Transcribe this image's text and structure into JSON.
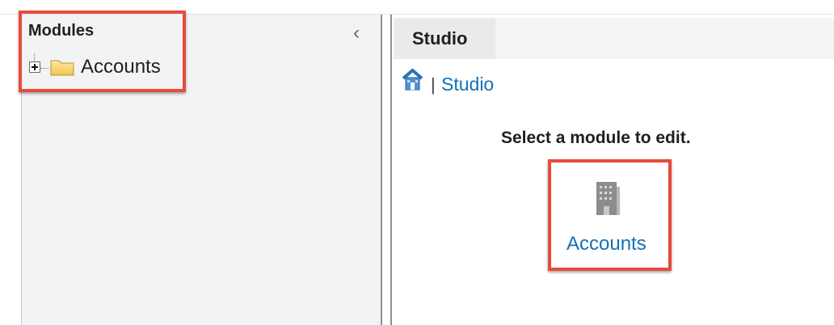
{
  "left_panel": {
    "title": "Modules",
    "tree": [
      {
        "label": "Accounts"
      }
    ],
    "collapse_glyph": "‹"
  },
  "right_panel": {
    "tab": "Studio",
    "breadcrumb": {
      "separator": "|",
      "link": "Studio"
    },
    "instruction": "Select a module to edit.",
    "module_button": "Accounts"
  },
  "icons": {
    "collapse": "chevron-left-icon",
    "expand": "plus-square-icon",
    "folder": "folder-icon",
    "home": "home-icon",
    "building": "building-icon"
  },
  "colors": {
    "link": "#1272b7",
    "highlight_border": "#e64c3c",
    "panel_background": "#f2f3f4",
    "tab_background": "#e9eaeb"
  }
}
